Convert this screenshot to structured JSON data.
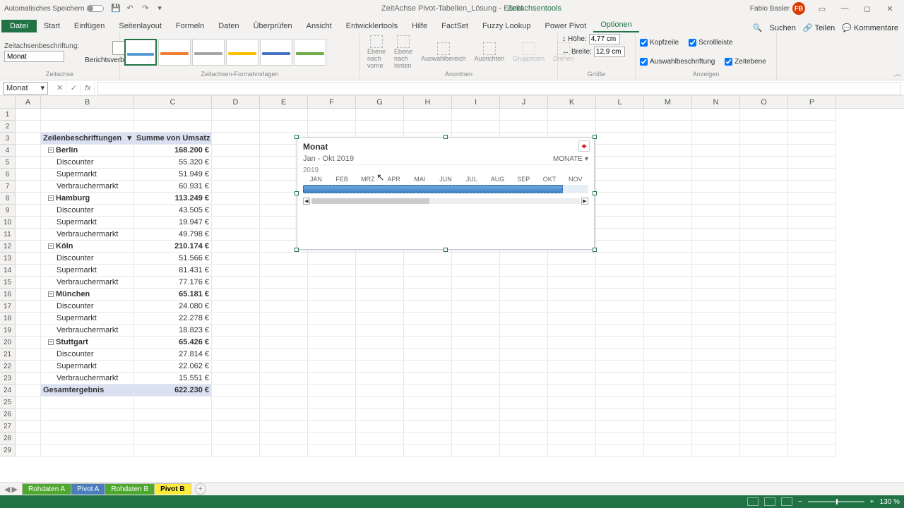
{
  "title": {
    "autosave": "Automatisches Speichern",
    "doc": "ZeitAchse Pivot-Tabellen_Lösung - Excel",
    "context": "Zeitachsentools",
    "user": "Fabio Basler",
    "initials": "FB"
  },
  "tabs": {
    "file": "Datei",
    "items": [
      "Start",
      "Einfügen",
      "Seitenlayout",
      "Formeln",
      "Daten",
      "Überprüfen",
      "Ansicht",
      "Entwicklertools",
      "Hilfe",
      "FactSet",
      "Fuzzy Lookup",
      "Power Pivot",
      "Optionen"
    ],
    "search": "Suchen",
    "share": "Teilen",
    "comments": "Kommentare"
  },
  "ribbon": {
    "caption_label": "Zeitachsenbeschriftung:",
    "caption_value": "Monat",
    "report_conn": "Berichtsverbindungen",
    "group1": "Zeitachse",
    "group2": "Zeitachsen-Formatvorlagen",
    "arrange": {
      "fwd": "Ebene nach vorne",
      "back": "Ebene nach hinten",
      "selpane": "Auswahlbereich",
      "align": "Ausrichten",
      "group": "Gruppieren",
      "rotate": "Drehen",
      "label": "Anordnen"
    },
    "size": {
      "h_label": "Höhe:",
      "h_val": "4,77 cm",
      "w_label": "Breite:",
      "w_val": "12,9 cm",
      "label": "Größe"
    },
    "show": {
      "c1": "Kopfzeile",
      "c2": "Scrollleiste",
      "c3": "Auswahlbeschriftung",
      "c4": "Zeitebene",
      "label": "Anzeigen"
    }
  },
  "namebox": "Monat",
  "columns": [
    "A",
    "B",
    "C",
    "D",
    "E",
    "F",
    "G",
    "H",
    "I",
    "J",
    "K",
    "L",
    "M",
    "N",
    "O",
    "P"
  ],
  "pivot": {
    "h1": "Zeilenbeschriftungen",
    "h2": "Summe von Umsatz",
    "groups": [
      {
        "city": "Berlin",
        "total": "168.200 €",
        "rows": [
          [
            "Discounter",
            "55.320 €"
          ],
          [
            "Supermarkt",
            "51.949 €"
          ],
          [
            "Verbrauchermarkt",
            "60.931 €"
          ]
        ]
      },
      {
        "city": "Hamburg",
        "total": "113.249 €",
        "rows": [
          [
            "Discounter",
            "43.505 €"
          ],
          [
            "Supermarkt",
            "19.947 €"
          ],
          [
            "Verbrauchermarkt",
            "49.798 €"
          ]
        ]
      },
      {
        "city": "Köln",
        "total": "210.174 €",
        "rows": [
          [
            "Discounter",
            "51.566 €"
          ],
          [
            "Supermarkt",
            "81.431 €"
          ],
          [
            "Verbrauchermarkt",
            "77.176 €"
          ]
        ]
      },
      {
        "city": "München",
        "total": "65.181 €",
        "rows": [
          [
            "Discounter",
            "24.080 €"
          ],
          [
            "Supermarkt",
            "22.278 €"
          ],
          [
            "Verbrauchermarkt",
            "18.823 €"
          ]
        ]
      },
      {
        "city": "Stuttgart",
        "total": "65.426 €",
        "rows": [
          [
            "Discounter",
            "27.814 €"
          ],
          [
            "Supermarkt",
            "22.062 €"
          ],
          [
            "Verbrauchermarkt",
            "15.551 €"
          ]
        ]
      }
    ],
    "grand_label": "Gesamtergebnis",
    "grand_total": "622.230 €"
  },
  "slicer": {
    "title": "Monat",
    "period": "Jan - Okt 2019",
    "level": "MONATE",
    "year": "2019",
    "months": [
      "JAN",
      "FEB",
      "MRZ",
      "APR",
      "MAI",
      "JUN",
      "JUL",
      "AUG",
      "SEP",
      "OKT",
      "NOV"
    ]
  },
  "sheets": [
    "Rohdaten A",
    "Pivot A",
    "Rohdaten B",
    "Pivot B"
  ],
  "status": {
    "zoom": "130 %"
  }
}
